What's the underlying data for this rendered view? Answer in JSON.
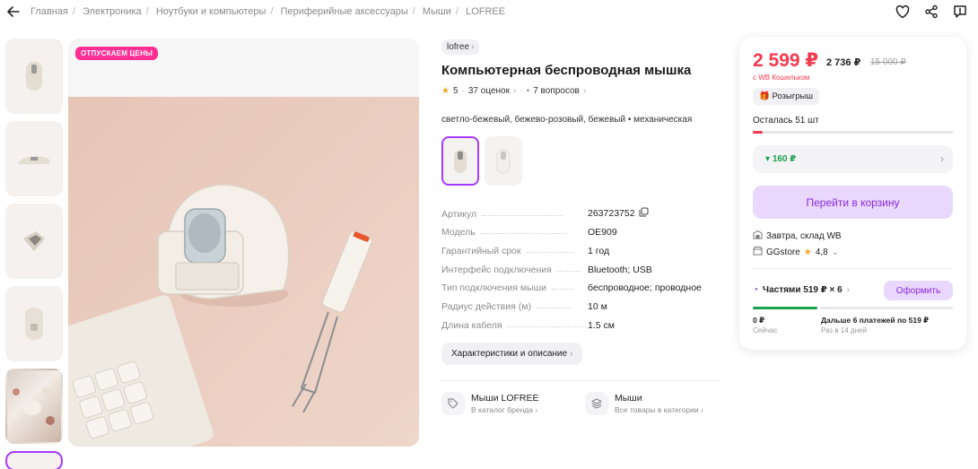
{
  "breadcrumb": [
    "Главная",
    "Электроника",
    "Ноутбуки и компьютеры",
    "Периферийные аксессуары",
    "Мыши",
    "LOFREE"
  ],
  "gallery": {
    "sale_badge": "ОТПУСКАЕМ ЦЕНЫ",
    "thumbnails": 6
  },
  "product": {
    "brand": "lofree",
    "title": "Компьютерная беспроводная мышка",
    "rating": "5",
    "reviews": "37 оценок",
    "questions": "7 вопросов",
    "variant_desc": "светло-бежевый, бежево-розовый, бежевый • механическая",
    "specs": [
      {
        "k": "Артикул",
        "v": "263723752"
      },
      {
        "k": "Модель",
        "v": "OE909"
      },
      {
        "k": "Гарантийный срок",
        "v": "1 год"
      },
      {
        "k": "Интерфейс подключения",
        "v": "Bluetooth; USB"
      },
      {
        "k": "Тип подключения мыши",
        "v": "беспроводное; проводное"
      },
      {
        "k": "Радиус действия (м)",
        "v": "10 м"
      },
      {
        "k": "Длина кабеля",
        "v": "1.5 см"
      }
    ],
    "chars_button": "Характеристики и описание",
    "links": [
      {
        "title": "Мыши LOFREE",
        "sub": "В каталог бренда"
      },
      {
        "title": "Мыши",
        "sub": "Все товары в категории"
      }
    ]
  },
  "price_card": {
    "price": "2 599 ₽",
    "price_wb": "2 736 ₽",
    "price_old": "15 000 ₽",
    "wallet_note": "с WB Кошельком",
    "raffle": "Розыгрыш",
    "remaining": "Осталась 51 шт",
    "stock_fraction": 0.05,
    "cashback": "160 ₽",
    "cart_button": "Перейти в корзину",
    "delivery": "Завтра, склад WB",
    "seller": "GGstore",
    "seller_rating": "4,8",
    "installments": "Частями 519 ₽ × 6",
    "installments_button": "Оформить",
    "now_amount": "0 ₽",
    "now_label": "Сейчас",
    "later_text": "Дальше 6 платежей по 519 ₽",
    "later_label": "Раз в 14 дней"
  },
  "colors": {
    "accent": "#a73afd",
    "price_red": "#f53a4f",
    "green": "#19a34a",
    "sale_pink": "#ff2e94"
  }
}
